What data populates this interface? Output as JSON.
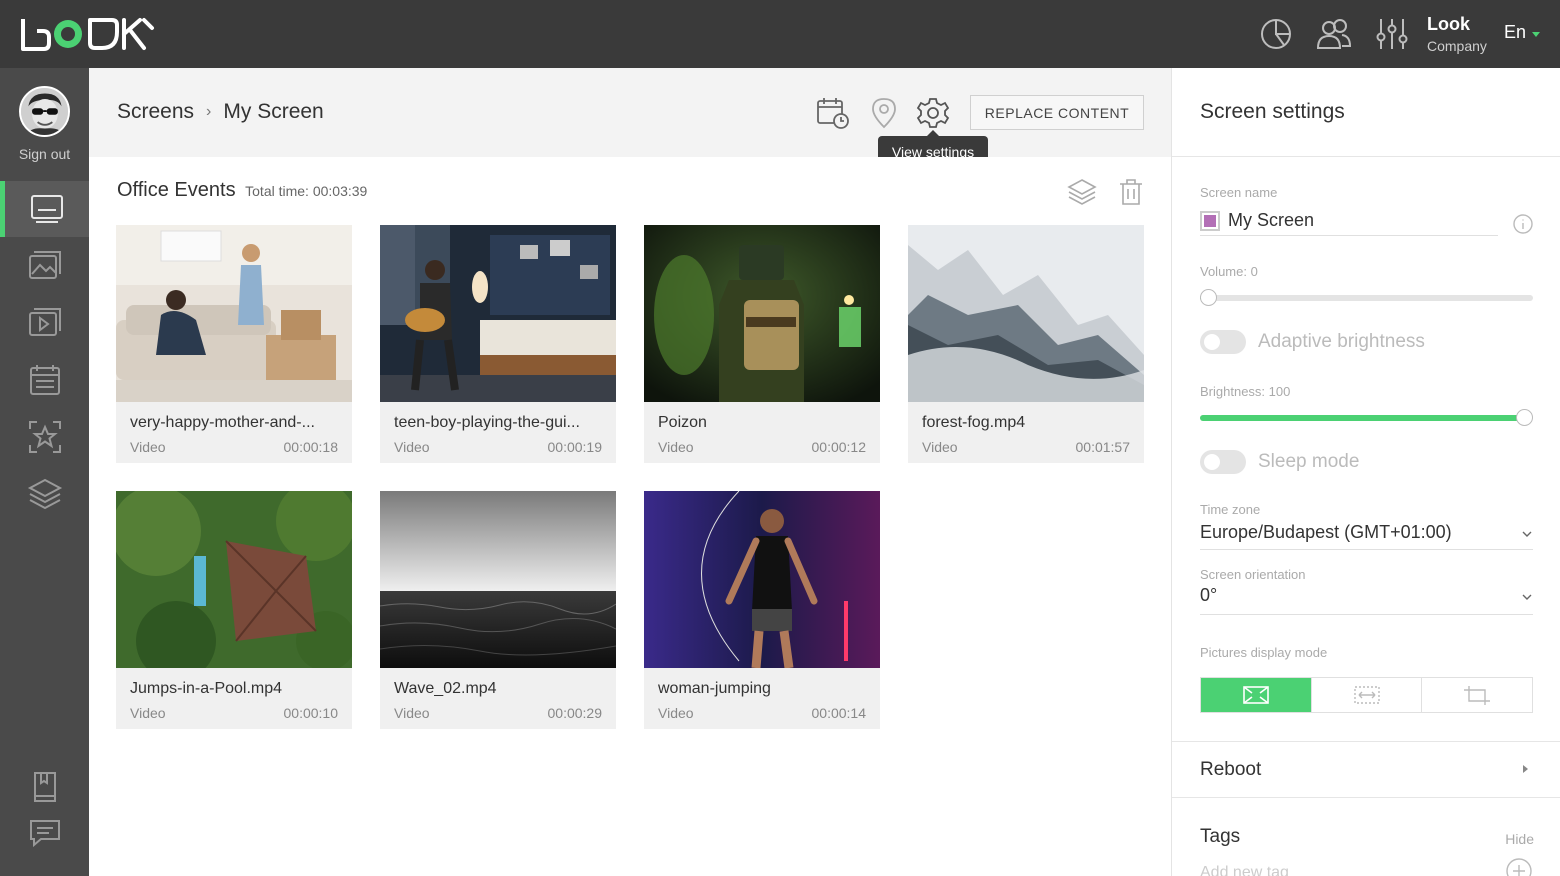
{
  "app": {
    "company_name": "Look",
    "company_sub": "Company",
    "language": "En",
    "accent_color": "#4bd173"
  },
  "user": {
    "sign_out_label": "Sign out"
  },
  "breadcrumb": {
    "root": "Screens",
    "current": "My Screen"
  },
  "header": {
    "replace_label": "REPLACE CONTENT",
    "tooltip": "View settings"
  },
  "playlist": {
    "title": "Office Events",
    "total_time": "Total time: 00:03:39",
    "items": [
      {
        "title": "very-happy-mother-and-...",
        "type": "Video",
        "duration": "00:00:18"
      },
      {
        "title": "teen-boy-playing-the-gui...",
        "type": "Video",
        "duration": "00:00:19"
      },
      {
        "title": "Poizon",
        "type": "Video",
        "duration": "00:00:12"
      },
      {
        "title": "forest-fog.mp4",
        "type": "Video",
        "duration": "00:01:57"
      },
      {
        "title": "Jumps-in-a-Pool.mp4",
        "type": "Video",
        "duration": "00:00:10"
      },
      {
        "title": "Wave_02.mp4",
        "type": "Video",
        "duration": "00:00:29"
      },
      {
        "title": "woman-jumping",
        "type": "Video",
        "duration": "00:00:14"
      }
    ]
  },
  "settings": {
    "title": "Screen settings",
    "screen_name_label": "Screen name",
    "screen_name_value": "My Screen",
    "volume_label": "Volume: 0",
    "volume_value": 0,
    "adaptive_brightness_label": "Adaptive brightness",
    "brightness_label": "Brightness: 100",
    "brightness_value": 100,
    "sleep_mode_label": "Sleep mode",
    "timezone_label": "Time zone",
    "timezone_value": "Europe/Budapest (GMT+01:00)",
    "orientation_label": "Screen orientation",
    "orientation_value": "0°",
    "display_mode_label": "Pictures display mode",
    "reboot_label": "Reboot",
    "tags_label": "Tags",
    "tags_hide": "Hide",
    "tag_placeholder": "Add new tag"
  }
}
